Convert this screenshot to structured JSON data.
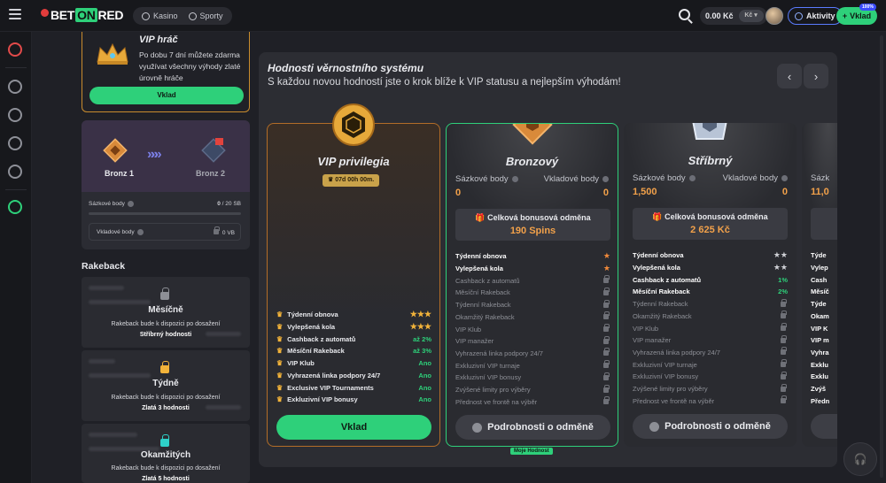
{
  "header": {
    "logo": {
      "a": "BET",
      "b": "ON",
      "c": "RED"
    },
    "nav": [
      "Kasino",
      "Sporty"
    ],
    "balance": "0.00 Kč",
    "currency_selector": "Kč",
    "aktivity": "Aktivity",
    "deposit": "Vklad",
    "deposit_badge": "100%"
  },
  "vip_promo": {
    "title": "VIP hráč",
    "desc": "Po dobu 7 dní můžete zdarma využívat všechny výhody zlaté úrovně hráče",
    "button": "Vklad"
  },
  "progress": {
    "current": "Bronz 1",
    "next": "Bronz 2",
    "bet_points_label": "Sázkové body",
    "bet_points_value": "0",
    "bet_points_target": "/ 20 SB",
    "deposit_points_label": "Vkladové body",
    "deposit_points_value": "0 VB"
  },
  "rakeback": {
    "title": "Rakeback",
    "items": [
      {
        "name": "Měsíčně",
        "desc": "Rakeback bude k dispozici po dosažení",
        "tier": "Stříbrný hodnosti"
      },
      {
        "name": "Týdně",
        "desc": "Rakeback bude k dispozici po dosažení",
        "tier": "Zlatá 3 hodnosti"
      },
      {
        "name": "Okamžitých",
        "desc": "Rakeback bude k dispozici po dosažení",
        "tier": "Zlatá 5 hodnosti"
      }
    ]
  },
  "main": {
    "title": "Hodnosti věrnostního systému",
    "subtitle": "S každou novou hodností jste o krok blíže k VIP statusu a nejlepším výhodám!",
    "prev": "‹",
    "next": "›",
    "my_rank": "Moje Hodnost"
  },
  "vip_tier": {
    "name": "VIP privilegia",
    "timer": "07d 00h 00m.",
    "features": [
      {
        "n": "Týdenní obnova",
        "v": "★★★"
      },
      {
        "n": "Vylepšená kola",
        "v": "★★★"
      },
      {
        "n": "Cashback z automatů",
        "v": "až 2%"
      },
      {
        "n": "Měsíční Rakeback",
        "v": "až 3%"
      },
      {
        "n": "VIP Klub",
        "v": "Ano"
      },
      {
        "n": "Vyhrazená linka podpory 24/7",
        "v": "Ano"
      },
      {
        "n": "Exclusive VIP Tournaments",
        "v": "Ano"
      },
      {
        "n": "Exkluzivní VIP bonusy",
        "v": "Ano"
      }
    ],
    "button": "Vklad"
  },
  "tiers": [
    {
      "name": "Bronzový",
      "bet_label": "Sázkové body",
      "dep_label": "Vkladové body",
      "bet": "0",
      "dep": "0",
      "bonus_label": "Celková bonusová odměna",
      "bonus": "190 Spins",
      "features": [
        {
          "n": "Týdenní obnova",
          "v": "★",
          "on": true
        },
        {
          "n": "Vylepšená kola",
          "v": "★",
          "on": true
        },
        {
          "n": "Cashback z automatů",
          "v": "",
          "on": false
        },
        {
          "n": "Měsíční Rakeback",
          "v": "",
          "on": false
        },
        {
          "n": "Týdenní Rakeback",
          "v": "",
          "on": false
        },
        {
          "n": "Okamžitý Rakeback",
          "v": "",
          "on": false
        },
        {
          "n": "VIP Klub",
          "v": "",
          "on": false
        },
        {
          "n": "VIP manažer",
          "v": "",
          "on": false
        },
        {
          "n": "Vyhrazená linka podpory 24/7",
          "v": "",
          "on": false
        },
        {
          "n": "Exkluzivní VIP turnaje",
          "v": "",
          "on": false
        },
        {
          "n": "Exkluzivní VIP bonusy",
          "v": "",
          "on": false
        },
        {
          "n": "Zvýšené limity pro výběry",
          "v": "",
          "on": false
        },
        {
          "n": "Přednost ve frontě na výběr",
          "v": "",
          "on": false
        }
      ],
      "button": "Podrobnosti o odměně"
    },
    {
      "name": "Stříbrný",
      "bet_label": "Sázkové body",
      "dep_label": "Vkladové body",
      "bet": "1,500",
      "dep": "0",
      "bonus_label": "Celková bonusová odměna",
      "bonus": "2 625 Kč",
      "features": [
        {
          "n": "Týdenní obnova",
          "v": "★★",
          "on": true
        },
        {
          "n": "Vylepšená kola",
          "v": "★★",
          "on": true
        },
        {
          "n": "Cashback z automatů",
          "v": "1%",
          "on": true
        },
        {
          "n": "Měsíční Rakeback",
          "v": "2%",
          "on": true
        },
        {
          "n": "Týdenní Rakeback",
          "v": "",
          "on": false
        },
        {
          "n": "Okamžitý Rakeback",
          "v": "",
          "on": false
        },
        {
          "n": "VIP Klub",
          "v": "",
          "on": false
        },
        {
          "n": "VIP manažer",
          "v": "",
          "on": false
        },
        {
          "n": "Vyhrazená linka podpory 24/7",
          "v": "",
          "on": false
        },
        {
          "n": "Exkluzivní VIP turnaje",
          "v": "",
          "on": false
        },
        {
          "n": "Exkluzivní VIP bonusy",
          "v": "",
          "on": false
        },
        {
          "n": "Zvýšené limity pro výběry",
          "v": "",
          "on": false
        },
        {
          "n": "Přednost ve frontě na výběr",
          "v": "",
          "on": false
        }
      ],
      "button": "Podrobnosti o odměně"
    },
    {
      "name": "",
      "bet_label": "Sázk",
      "dep_label": "",
      "bet": "11,0",
      "dep": "",
      "bonus_label": "",
      "bonus": "",
      "features": [
        {
          "n": "Týde",
          "v": "",
          "on": true
        },
        {
          "n": "Vylep",
          "v": "",
          "on": true
        },
        {
          "n": "Cash",
          "v": "",
          "on": true
        },
        {
          "n": "Měsíč",
          "v": "",
          "on": true
        },
        {
          "n": "Týde",
          "v": "",
          "on": true
        },
        {
          "n": "Okam",
          "v": "",
          "on": true
        },
        {
          "n": "VIP K",
          "v": "",
          "on": true
        },
        {
          "n": "VIP m",
          "v": "",
          "on": true
        },
        {
          "n": "Vyhra",
          "v": "",
          "on": true
        },
        {
          "n": "Exklu",
          "v": "",
          "on": true
        },
        {
          "n": "Exklu",
          "v": "",
          "on": true
        },
        {
          "n": "Zvýš",
          "v": "",
          "on": true
        },
        {
          "n": "Předn",
          "v": "",
          "on": true
        }
      ],
      "button": ""
    }
  ]
}
